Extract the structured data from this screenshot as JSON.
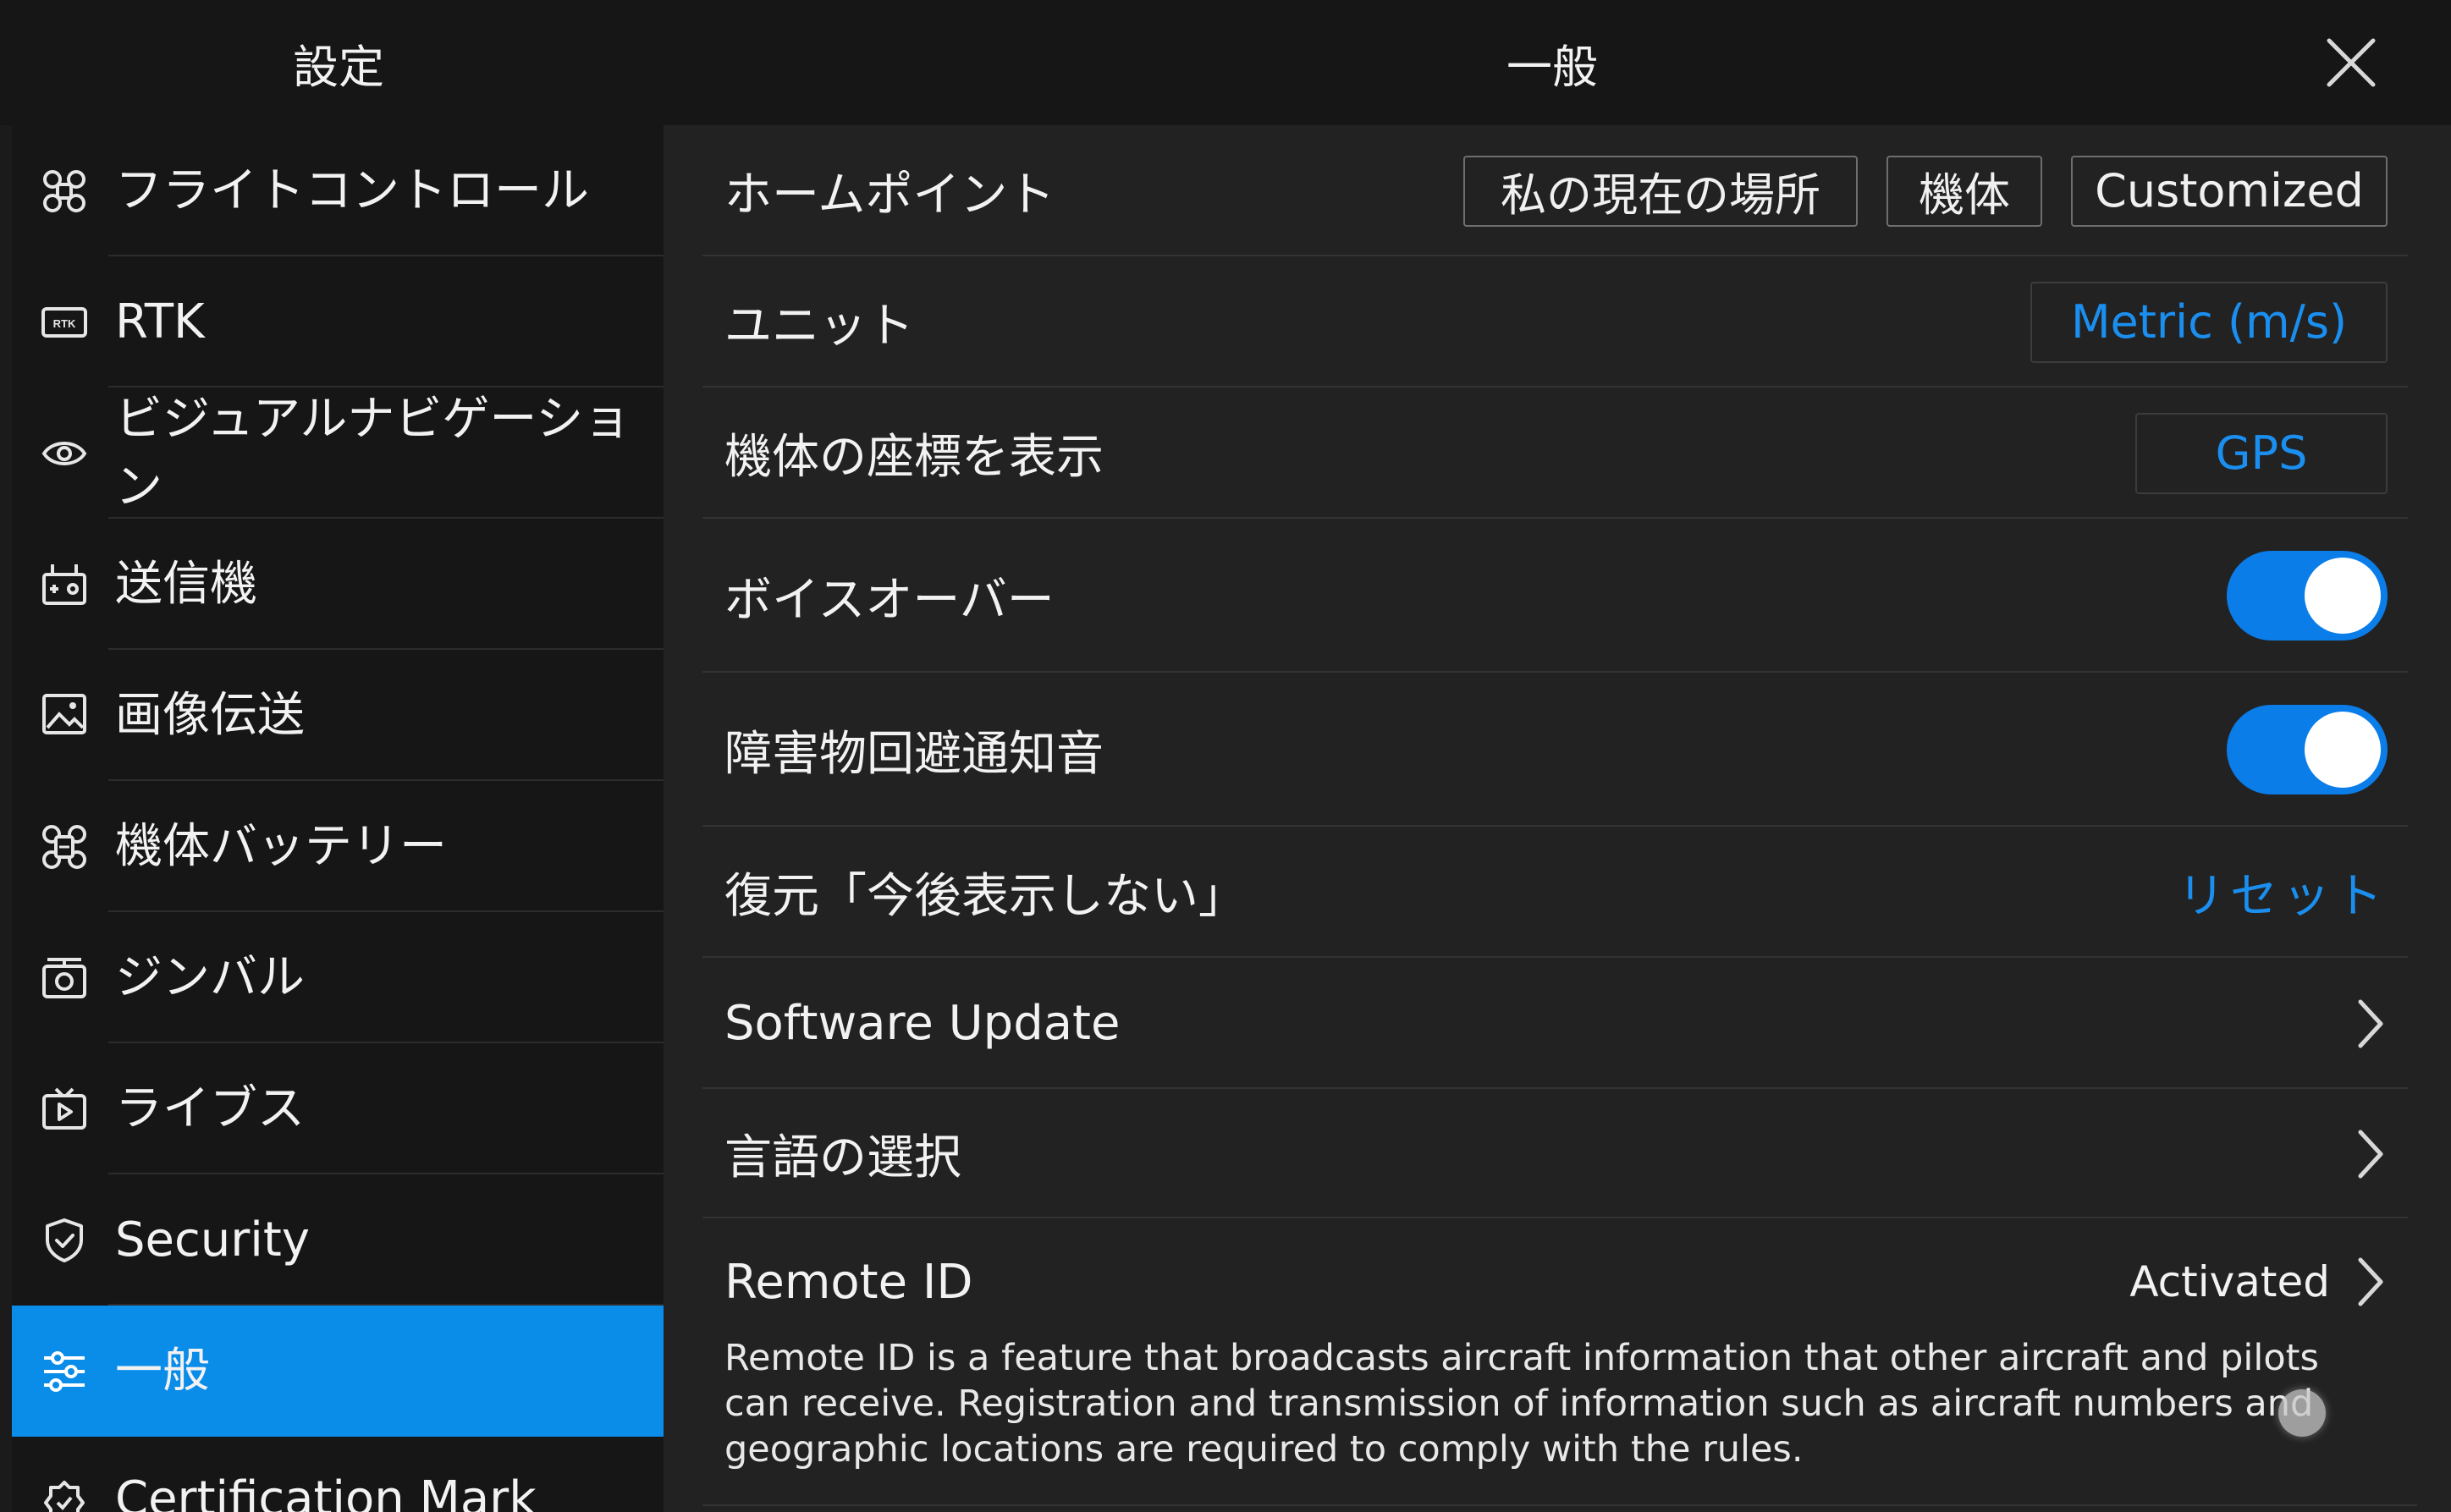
{
  "header": {
    "left_title": "設定",
    "title": "一般",
    "close_icon": "close-icon"
  },
  "sidebar": {
    "items": [
      {
        "label": "フライトコントロール",
        "icon": "drone-icon"
      },
      {
        "label": "RTK",
        "icon": "rtk-icon"
      },
      {
        "label": "ビジュアルナビゲーション",
        "icon": "eye-icon"
      },
      {
        "label": "送信機",
        "icon": "remote-controller-icon"
      },
      {
        "label": "画像伝送",
        "icon": "image-transmission-icon"
      },
      {
        "label": "機体バッテリー",
        "icon": "aircraft-battery-icon"
      },
      {
        "label": "ジンバル",
        "icon": "gimbal-camera-icon"
      },
      {
        "label": "ライブス",
        "icon": "live-stream-icon"
      },
      {
        "label": "Security",
        "icon": "shield-icon"
      },
      {
        "label": "一般",
        "icon": "sliders-icon",
        "active": true
      },
      {
        "label": "Certification Mark",
        "icon": "certification-icon"
      }
    ]
  },
  "main": {
    "home_point": {
      "label": "ホームポイント",
      "options": [
        "私の現在の場所",
        "機体",
        "Customized"
      ]
    },
    "unit": {
      "label": "ユニット",
      "value": "Metric (m/s)"
    },
    "coordinates": {
      "label": "機体の座標を表示",
      "value": "GPS"
    },
    "voiceover": {
      "label": "ボイスオーバー",
      "enabled": true
    },
    "obstacle_sound": {
      "label": "障害物回避通知音",
      "enabled": true
    },
    "restore_dont_show": {
      "label": "復元「今後表示しない」",
      "action": "リセット"
    },
    "software_update": {
      "label": "Software Update"
    },
    "language": {
      "label": "言語の選択"
    },
    "remote_id": {
      "label": "Remote ID",
      "status": "Activated",
      "description": "Remote ID is a feature that broadcasts aircraft information that other aircraft and pilots can receive. Registration and transmission of information such as aircraft numbers and geographic locations are required to comply with the rules."
    }
  },
  "colors": {
    "accent": "#0a8ce9",
    "link": "#1a8ff0",
    "background": "#222222",
    "sidebar_bg": "#161616"
  }
}
